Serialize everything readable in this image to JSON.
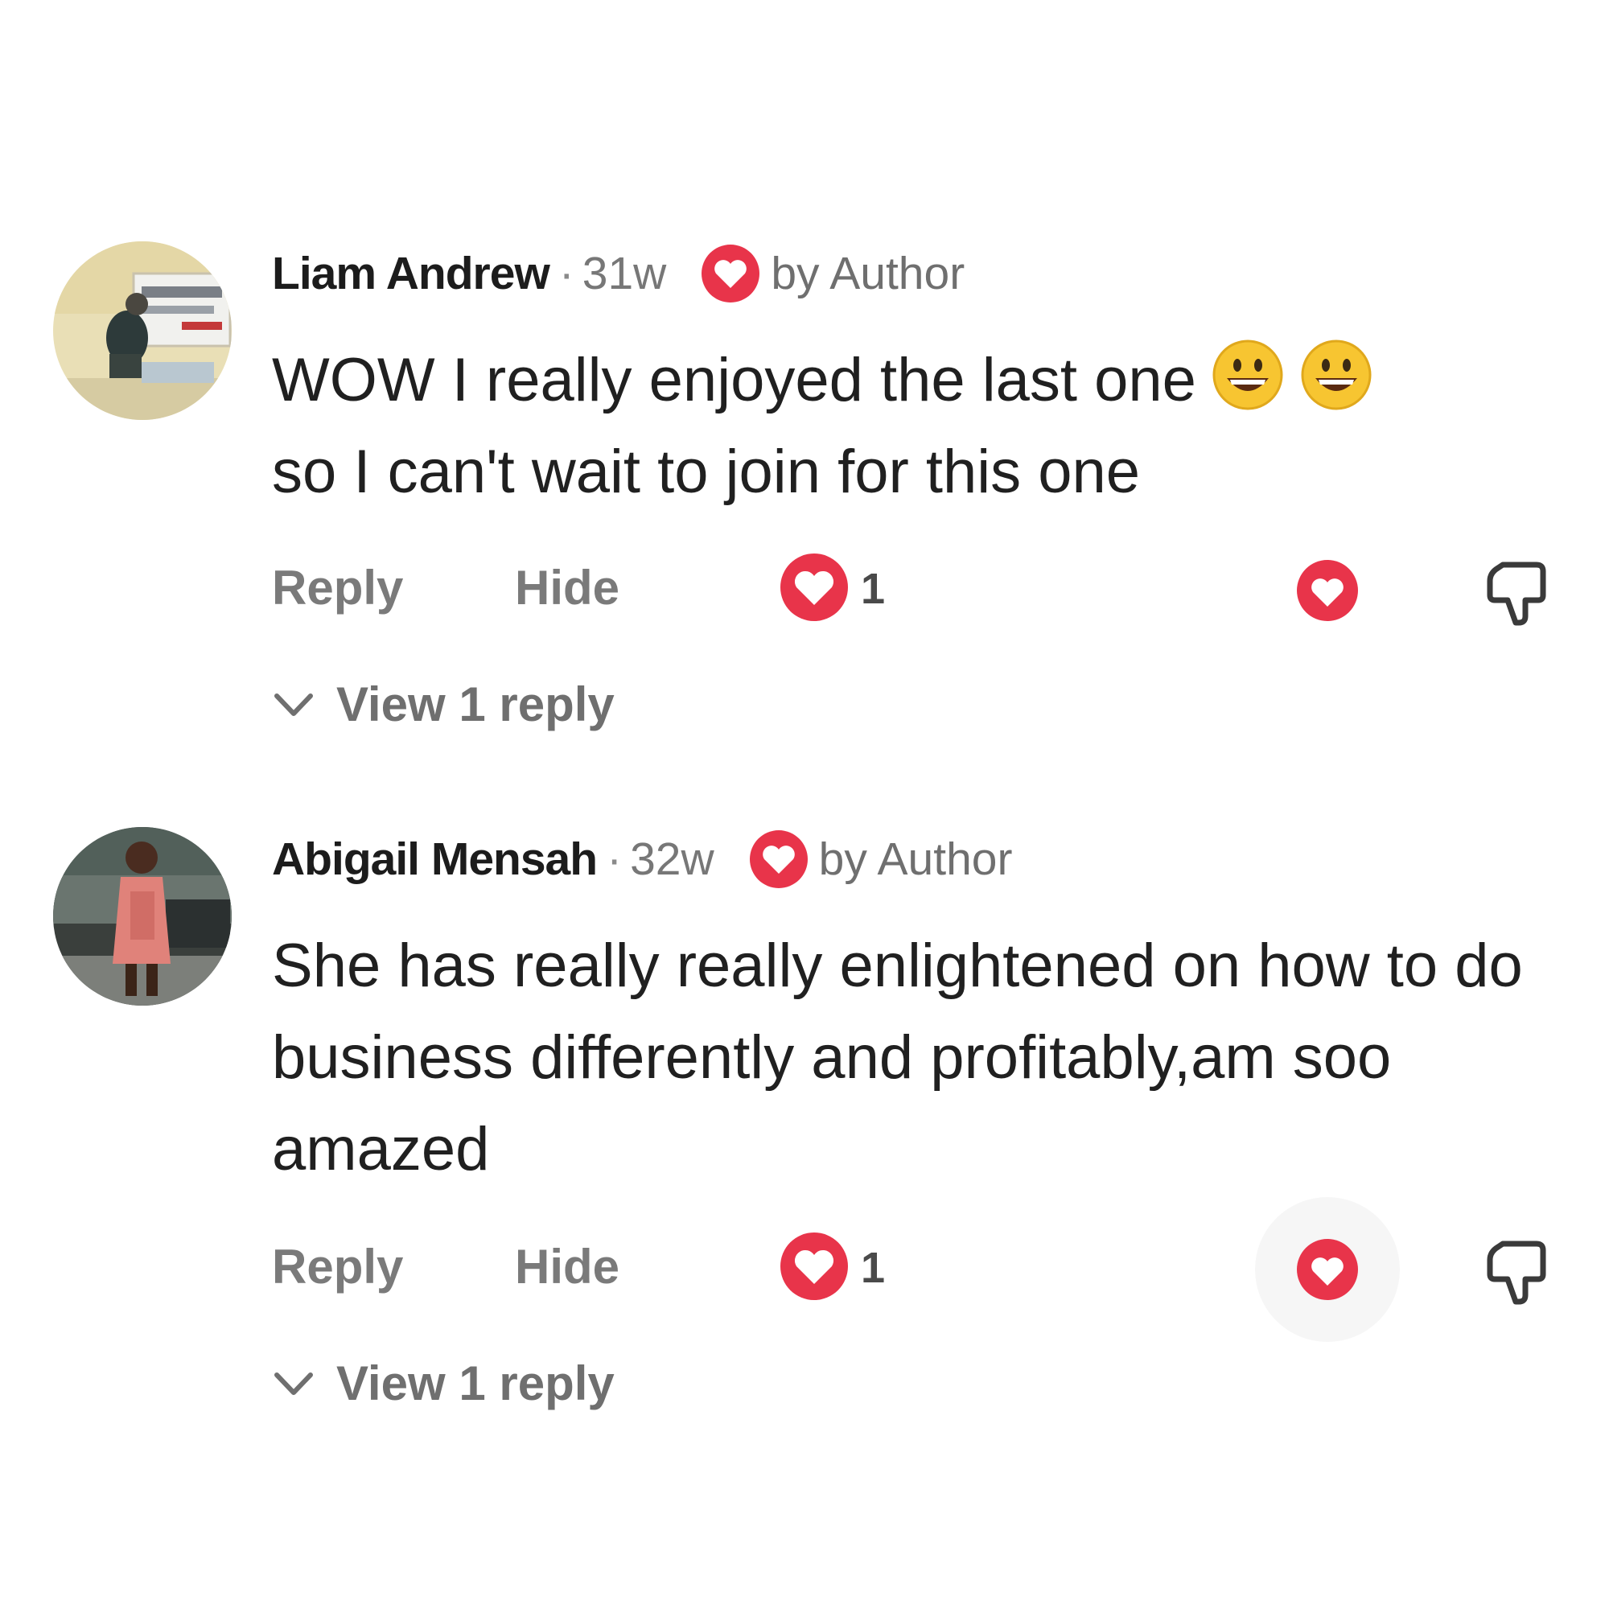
{
  "comments": [
    {
      "author": "Liam Andrew",
      "separator": "·",
      "time": "31w",
      "author_badge": "by Author",
      "text": "WOW I really enjoyed the last one",
      "text_line2": "so I can't wait to join for this one",
      "emojis": [
        "grinning-face-emoji",
        "grinning-face-emoji"
      ],
      "reply_label": "Reply",
      "hide_label": "Hide",
      "like_count": "1",
      "view_replies_label": "View 1 reply"
    },
    {
      "author": "Abigail Mensah",
      "separator": "·",
      "time": "32w",
      "author_badge": "by Author",
      "text": "She has really really enlightened on how to do business differently and profitably,am soo amazed",
      "reply_label": "Reply",
      "hide_label": "Hide",
      "like_count": "1",
      "view_replies_label": "View 1 reply"
    }
  ],
  "colors": {
    "heart_red": "#e8344a",
    "muted_text": "#7a7a7a"
  },
  "icons": [
    "avatar",
    "heart-icon",
    "love-icon",
    "dislike-icon",
    "chevron-down-icon",
    "grinning-face-emoji"
  ]
}
